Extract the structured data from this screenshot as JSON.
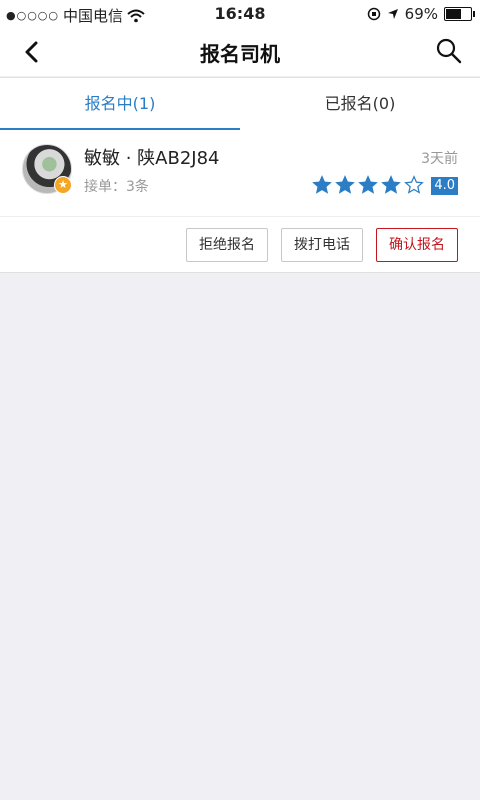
{
  "statusbar": {
    "carrier": "中国电信",
    "time": "16:48",
    "battery_percent": "69%",
    "battery_level": 0.69
  },
  "navbar": {
    "title": "报名司机"
  },
  "tabs": [
    {
      "label": "报名中(1)",
      "active": true
    },
    {
      "label": "已报名(0)",
      "active": false
    }
  ],
  "driver": {
    "name": "敏敏 · 陕AB2J84",
    "orders": "接单：3条",
    "time_ago": "3天前",
    "rating": "4.0",
    "rating_value": 4,
    "rating_max": 5
  },
  "actions": {
    "reject": "拒绝报名",
    "call": "拨打电话",
    "confirm": "确认报名"
  },
  "colors": {
    "accent": "#2b7ec5",
    "danger": "#c4161c",
    "badge": "#f5a623"
  },
  "icons": {
    "back": "chevron-left-icon",
    "search": "search-icon",
    "wifi": "wifi-icon",
    "location": "location-arrow-icon",
    "lock": "orientation-lock-icon"
  }
}
